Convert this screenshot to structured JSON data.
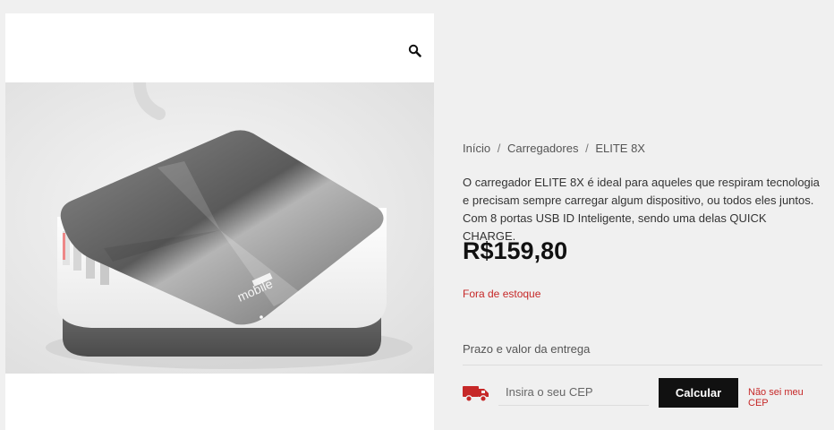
{
  "product": {
    "price": "R$159,80",
    "stock_status": "Fora de estoque",
    "description": "O carregador ELITE 8X é ideal para aqueles que respiram tecnologia e precisam sempre carregar algum dispositivo, ou todos eles juntos. Com 8 portas USB ID Inteligente, sendo uma delas QUICK CHARGE.",
    "image_brand_text": "mobile"
  },
  "breadcrumb": {
    "home": "Início",
    "category": "Carregadores",
    "current": "ELITE 8X",
    "separator": "/"
  },
  "shipping": {
    "title": "Prazo e valor da entrega",
    "cep_placeholder": "Insira o seu CEP",
    "calculate_label": "Calcular",
    "no_cep_link": "Não sei meu CEP"
  },
  "icons": {
    "zoom": "magnifier-icon",
    "truck": "truck-icon"
  },
  "colors": {
    "price": "#111111",
    "out_of_stock": "#c62828",
    "button_bg": "#111111",
    "truck": "#c62828"
  }
}
